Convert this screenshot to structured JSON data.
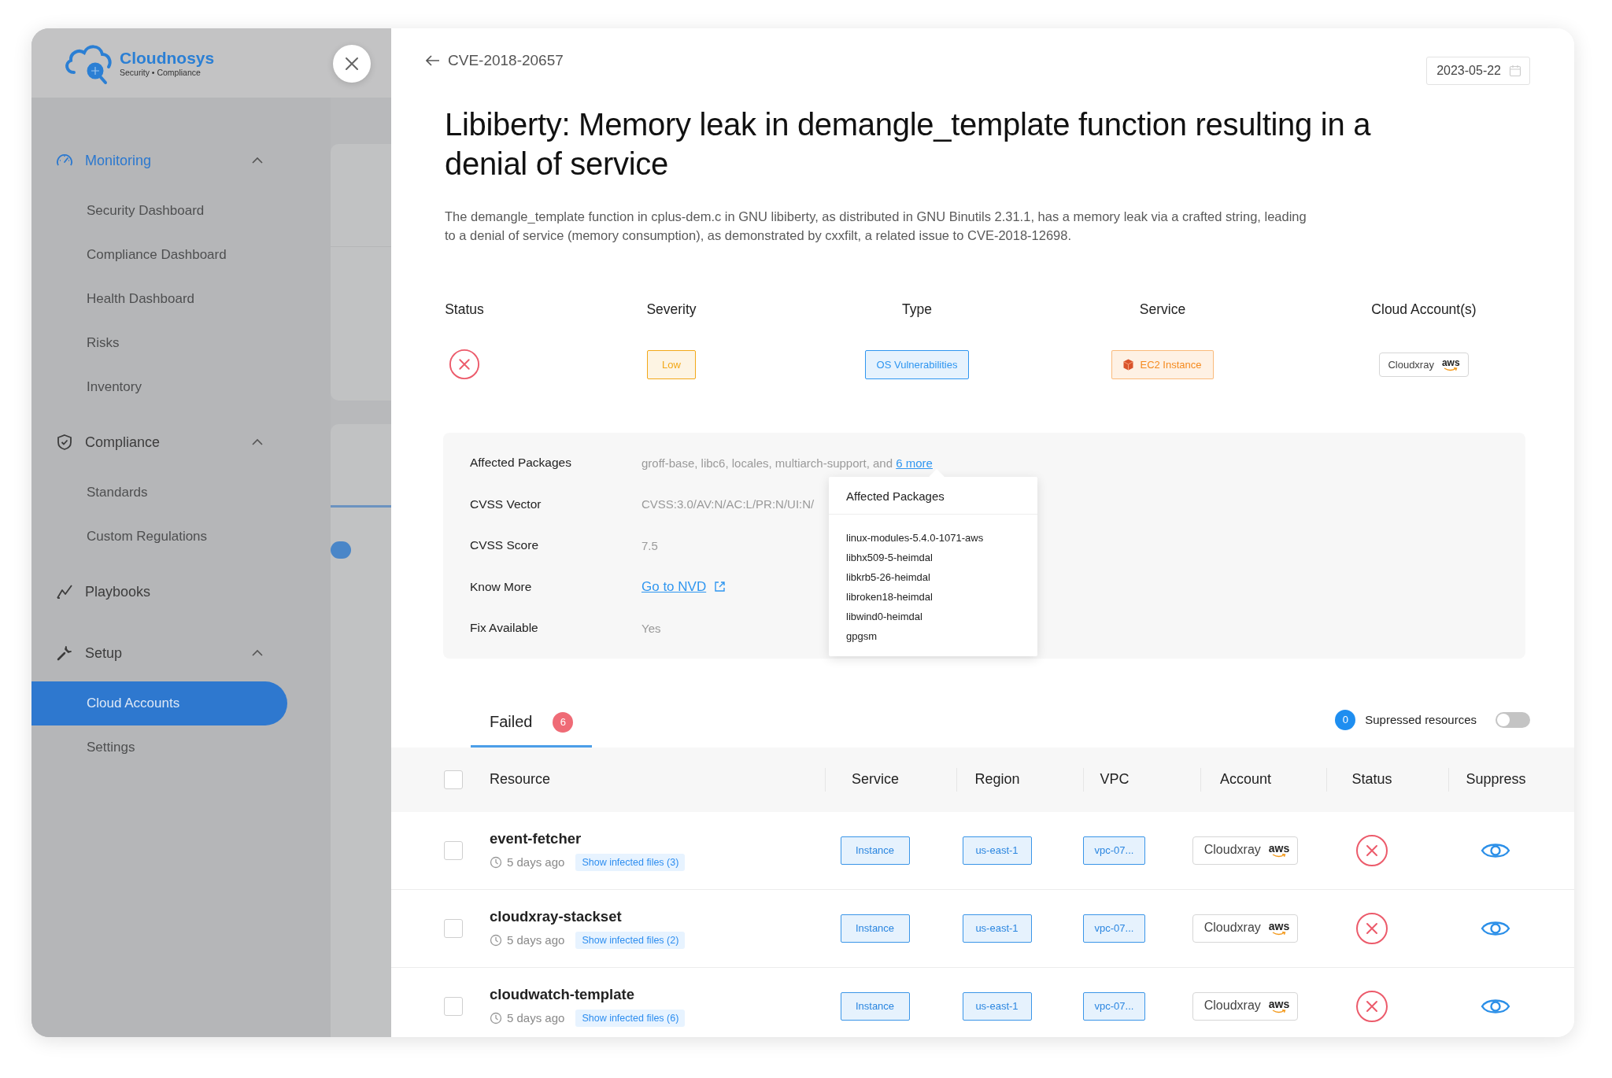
{
  "sidebar": {
    "brand": {
      "name": "Cloudnosys",
      "tagline": "Security • Compliance"
    },
    "groups": [
      {
        "label": "Monitoring",
        "kind": "group",
        "active": true,
        "expanded": true,
        "items": [
          {
            "label": "Security Dashboard",
            "selected": false
          },
          {
            "label": "Compliance Dashboard",
            "selected": false
          },
          {
            "label": "Health Dashboard",
            "selected": false
          },
          {
            "label": "Risks",
            "selected": false
          },
          {
            "label": "Inventory",
            "selected": false
          }
        ]
      },
      {
        "label": "Compliance",
        "kind": "group",
        "active": false,
        "expanded": true,
        "items": [
          {
            "label": "Standards",
            "selected": false
          },
          {
            "label": "Custom Regulations",
            "selected": false
          }
        ]
      },
      {
        "label": "Playbooks",
        "kind": "link",
        "active": false
      },
      {
        "label": "Setup",
        "kind": "group",
        "active": false,
        "expanded": true,
        "items": [
          {
            "label": "Cloud Accounts",
            "selected": true
          },
          {
            "label": "Settings",
            "selected": false
          }
        ]
      }
    ]
  },
  "header": {
    "back_label": "CVE-2018-20657",
    "date": "2023-05-22"
  },
  "title": "Libiberty: Memory leak in demangle_template function resulting in a denial of service",
  "description": "The demangle_template function in cplus-dem.c in GNU libiberty, as distributed in GNU Binutils 2.31.1, has a memory leak via a crafted string, leading to a denial of service (memory consumption), as demonstrated by cxxfilt, a related issue to CVE-2018-12698.",
  "summary": [
    {
      "label": "Status",
      "kind": "status",
      "failed": true
    },
    {
      "label": "Severity",
      "kind": "tag",
      "value": "Low",
      "color": "#f2a818"
    },
    {
      "label": "Type",
      "kind": "tag",
      "value": "OS Vulnerabilities",
      "color": "#2f96f0"
    },
    {
      "label": "Service",
      "kind": "service",
      "value": "EC2 Instance",
      "color": "#f58a1f"
    },
    {
      "label": "Cloud Account(s)",
      "kind": "account",
      "name": "Cloudxray",
      "provider": "aws"
    }
  ],
  "details": [
    {
      "label": "Affected Packages",
      "kind": "text-link",
      "value": "groff-base, libc6, locales, multiarch-support, and",
      "link": "6 more"
    },
    {
      "label": "CVSS Vector",
      "kind": "text",
      "value": "CVSS:3.0/AV:N/AC:L/PR:N/UI:N/"
    },
    {
      "label": "CVSS Score",
      "kind": "text",
      "value": "7.5"
    },
    {
      "label": "Know More",
      "kind": "link",
      "value": "Go to NVD"
    },
    {
      "label": "Fix Available",
      "kind": "text",
      "value": "Yes"
    }
  ],
  "popover": {
    "title": "Affected Packages",
    "items": [
      "linux-modules-5.4.0-1071-aws",
      "libhx509-5-heimdal",
      "libkrb5-26-heimdal",
      "libroken18-heimdal",
      "libwind0-heimdal",
      "gpgsm"
    ]
  },
  "tabs": [
    {
      "label": "Failed",
      "count": "6",
      "selected": true
    }
  ],
  "suppressed": {
    "count": "0",
    "label": "Supressed resources",
    "on": false
  },
  "table": {
    "columns": [
      "Resource",
      "Service",
      "Region",
      "VPC",
      "Account",
      "Status",
      "Suppress"
    ],
    "all_checked": false,
    "rows": [
      {
        "checked": false,
        "name": "event-fetcher",
        "age": "5 days ago",
        "files_link": "Show infected files (3)",
        "service": "Instance",
        "region": "us-east-1",
        "vpc": "vpc-07...",
        "account": {
          "name": "Cloudxray",
          "provider": "aws"
        },
        "failed": true,
        "suppressed": false
      },
      {
        "checked": false,
        "name": "cloudxray-stackset",
        "age": "5 days ago",
        "files_link": "Show infected files (2)",
        "service": "Instance",
        "region": "us-east-1",
        "vpc": "vpc-07...",
        "account": {
          "name": "Cloudxray",
          "provider": "aws"
        },
        "failed": true,
        "suppressed": false
      },
      {
        "checked": false,
        "name": "cloudwatch-template",
        "age": "5 days ago",
        "files_link": "Show infected files (6)",
        "service": "Instance",
        "region": "us-east-1",
        "vpc": "vpc-07...",
        "account": {
          "name": "Cloudxray",
          "provider": "aws"
        },
        "failed": true,
        "suppressed": false
      }
    ]
  }
}
